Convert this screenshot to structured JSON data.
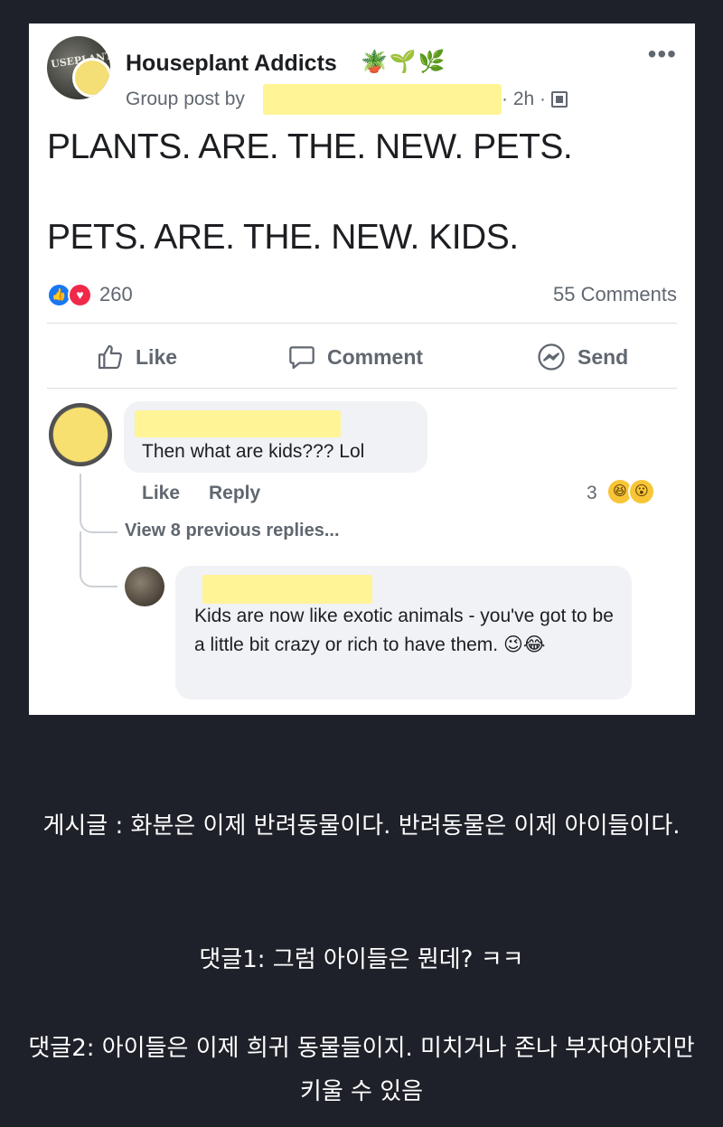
{
  "post": {
    "group_name": "Houseplant Addicts",
    "group_icons": "🪴🌱🌿",
    "avatar_text": "USEPLANT",
    "more": "•••",
    "meta_prefix": "Group post by",
    "time": "· 2h ·",
    "line1": "PLANTS. ARE. THE. NEW. PETS.",
    "line2": "PETS. ARE. THE. NEW. KIDS.",
    "reaction_count": "260",
    "comments_count": "55 Comments",
    "actions": {
      "like": "Like",
      "comment": "Comment",
      "send": "Send"
    },
    "reaction_icons": [
      "like-icon",
      "love-icon"
    ]
  },
  "comments": [
    {
      "text": "Then what are kids??? Lol",
      "like": "Like",
      "reply": "Reply",
      "reaction_count": "3",
      "reaction_emojis": [
        "😆",
        "😮"
      ]
    },
    {
      "view_replies": "View 8 previous replies...",
      "text": "Kids are now like exotic animals - you've got to be a little bit crazy or rich to have them. 😉😂"
    }
  ],
  "caption": {
    "line1": "게시글 : 화분은 이제 반려동물이다. 반려동물은 이제 아이들이다.",
    "line2": "댓글1: 그럼 아이들은 뭔데? ㅋㅋ",
    "line3": "댓글2: 아이들은 이제 희귀 동물들이지. 미치거나 존나 부자여야지만 키울 수 있음"
  },
  "colors": {
    "background": "#1e2129",
    "card": "#ffffff",
    "redaction": "#fff496",
    "like_blue": "#1877f2",
    "love_red": "#f0284a",
    "muted_text": "#606770"
  }
}
